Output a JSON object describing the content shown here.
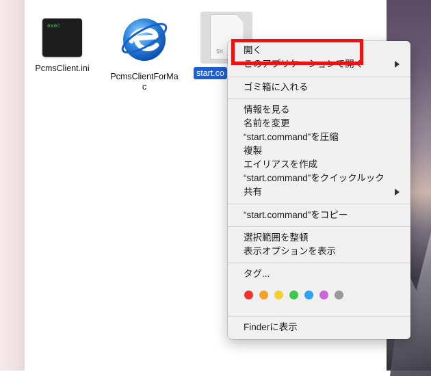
{
  "desktop": {
    "files": [
      {
        "name": "PcmsClient.ini",
        "icon": "terminal-exec-icon",
        "icon_text": "exec"
      },
      {
        "name_line1": "PcmsClientForMa",
        "name_line2": "c",
        "icon": "ie-browser-icon"
      },
      {
        "name": "start.co",
        "icon": "document-icon",
        "icon_text": "SH",
        "selected": true
      }
    ]
  },
  "context_menu": {
    "items": {
      "open": "開く",
      "open_with": "このアプリケーションで開く",
      "trash": "ゴミ箱に入れる",
      "get_info": "情報を見る",
      "rename": "名前を変更",
      "compress": "“start.command”を圧縮",
      "duplicate": "複製",
      "make_alias": "エイリアスを作成",
      "quick_look": "“start.command”をクイックルック",
      "share": "共有",
      "copy": "“start.command”をコピー",
      "clean_up": "選択範囲を整頓",
      "view_options": "表示オプションを表示",
      "tags": "タグ...",
      "show_in_finder": "Finderに表示"
    },
    "tag_colors": [
      "#f2322b",
      "#f7a12a",
      "#f5cf2c",
      "#41c84a",
      "#2da3f5",
      "#c969d8",
      "#9a9a9a"
    ]
  },
  "annotation": {
    "highlight_color": "#ee1111"
  }
}
